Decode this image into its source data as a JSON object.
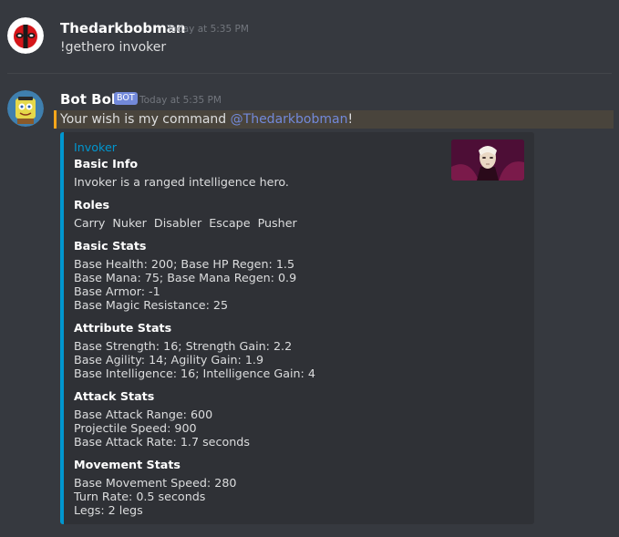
{
  "message1": {
    "username": "Thedarkbobman",
    "timestamp": "Today at 5:35 PM",
    "text": "!gethero invoker"
  },
  "message2": {
    "username": "Bot Bob",
    "tag": "BOT",
    "timestamp": "Today at 5:35 PM",
    "text_before": "Your wish is my command ",
    "mention": "@Thedarkbobman",
    "text_after": "!"
  },
  "embed": {
    "accent_color": "#0096cf",
    "title": "Invoker",
    "basic_info": {
      "name": "Basic Info",
      "value": "Invoker is a ranged intelligence hero."
    },
    "roles": {
      "name": "Roles",
      "value": "Carry  Nuker  Disabler  Escape  Pusher"
    },
    "basic_stats": {
      "name": "Basic Stats",
      "lines": [
        "Base Health: 200; Base HP Regen: 1.5",
        "Base Mana: 75; Base Mana Regen: 0.9",
        "Base Armor: -1",
        "Base Magic Resistance: 25"
      ]
    },
    "attribute_stats": {
      "name": "Attribute Stats",
      "lines": [
        "Base Strength: 16; Strength Gain: 2.2",
        "Base Agility: 14; Agility Gain: 1.9",
        "Base Intelligence: 16; Intelligence Gain: 4"
      ]
    },
    "attack_stats": {
      "name": "Attack Stats",
      "lines": [
        "Base Attack Range: 600",
        "Projectile Speed: 900",
        "Base Attack Rate: 1.7 seconds"
      ]
    },
    "movement_stats": {
      "name": "Movement Stats",
      "lines": [
        "Base Movement Speed: 280",
        "Turn Rate: 0.5 seconds",
        "Legs: 2 legs"
      ]
    }
  }
}
